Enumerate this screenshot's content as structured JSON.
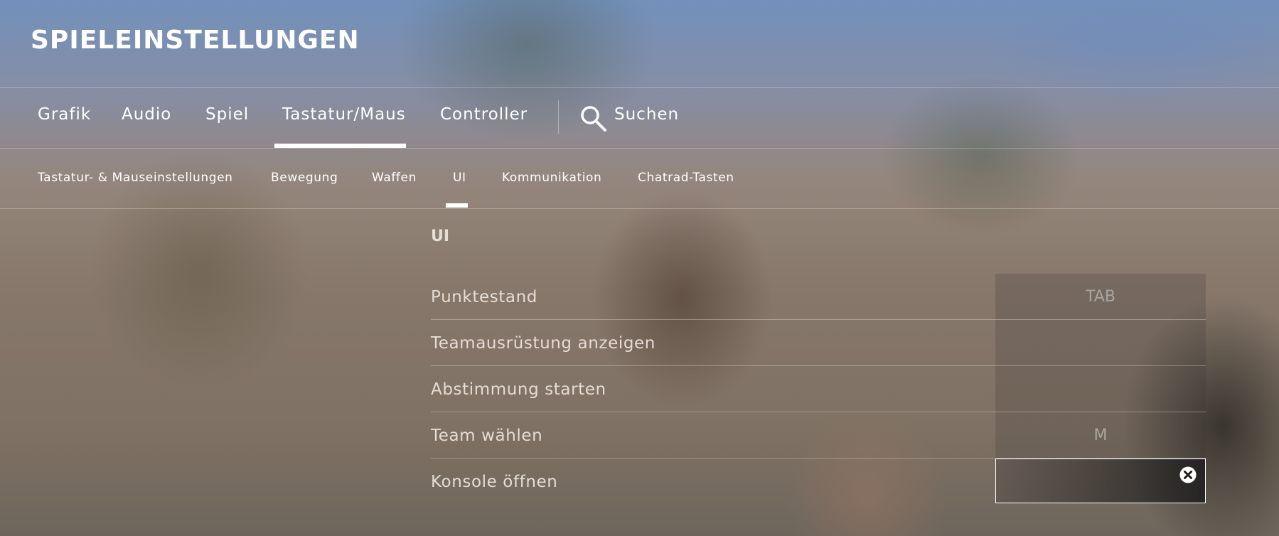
{
  "page_title": "SPIELEINSTELLUNGEN",
  "main_tabs": [
    {
      "label": "Grafik"
    },
    {
      "label": "Audio"
    },
    {
      "label": "Spiel"
    },
    {
      "label": "Tastatur/Maus"
    },
    {
      "label": "Controller"
    }
  ],
  "active_main_tab": "Tastatur/Maus",
  "search": {
    "label": "Suchen",
    "icon": "search-icon"
  },
  "sub_tabs": [
    {
      "label": "Tastatur- & Mauseinstellungen"
    },
    {
      "label": "Bewegung"
    },
    {
      "label": "Waffen"
    },
    {
      "label": "UI"
    },
    {
      "label": "Kommunikation"
    },
    {
      "label": "Chatrad-Tasten"
    }
  ],
  "active_sub_tab": "UI",
  "section_title": "UI",
  "bindings": [
    {
      "label": "Punktestand",
      "key": "TAB"
    },
    {
      "label": "Teamausrüstung anzeigen",
      "key": ""
    },
    {
      "label": "Abstimmung starten",
      "key": ""
    },
    {
      "label": "Team wählen",
      "key": "M"
    },
    {
      "label": "Konsole öffnen",
      "key": ""
    }
  ],
  "colors": {
    "accent": "#ffffff",
    "text": "#e4dcd5",
    "key_text": "#a9a5a2"
  }
}
